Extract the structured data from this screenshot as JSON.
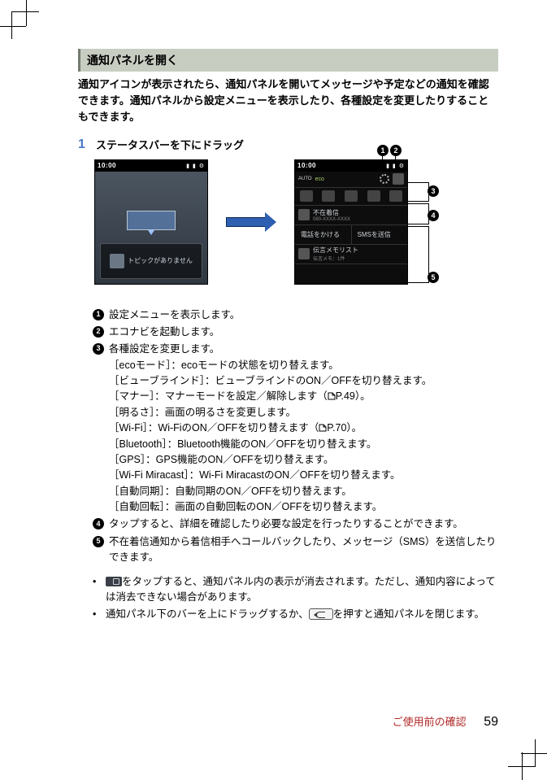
{
  "section_title": "通知パネルを開く",
  "intro": "通知アイコンが表示されたら、通知パネルを開いてメッセージや予定などの通知を確認できます。通知パネルから設定メニューを表示したり、各種設定を変更したりすることもできます。",
  "step": {
    "num": "1",
    "text": "ステータスバーを下にドラッグ"
  },
  "phone": {
    "time": "10:00",
    "dock_text": "トピックがありません",
    "panel": {
      "auto_label": "AUTO",
      "eco_label": "eco",
      "missed_call": "不在着信",
      "missed_number": "080-XXXX-XXXX",
      "call_back": "電話をかける",
      "send_sms": "SMSを送信",
      "memo": "伝言メモリスト",
      "memo_sub": "伝言メモ：1件"
    }
  },
  "callouts": {
    "c1": "1",
    "c2": "2",
    "c3": "3",
    "c4": "4",
    "c5": "5"
  },
  "legend": {
    "l1": "設定メニューを表示します。",
    "l2": "エコナビを起動します。",
    "l3_head": "各種設定を変更します。",
    "l3_items": [
      "［ecoモード］：ecoモードの状態を切り替えます。",
      "［ビューブラインド］：ビューブラインドのON／OFFを切り替えます。",
      {
        "pre": "［マナー］：マナーモードを設定／解除します（",
        "ref": "P.49",
        "post": "）。"
      },
      "［明るさ］：画面の明るさを変更します。",
      {
        "pre": "［Wi-Fi］：Wi-FiのON／OFFを切り替えます（",
        "ref": "P.70",
        "post": "）。"
      },
      "［Bluetooth］：Bluetooth機能のON／OFFを切り替えます。",
      "［GPS］：GPS機能のON／OFFを切り替えます。",
      "［Wi-Fi Miracast］：Wi-Fi MiracastのON／OFFを切り替えます。",
      "［自動同期］：自動同期のON／OFFを切り替えます。",
      "［自動回転］：画面の自動回転のON／OFFを切り替えます。"
    ],
    "l4": "タップすると、詳細を確認したり必要な設定を行ったりすることができます。",
    "l5": "不在着信通知から着信相手へコールバックしたり、メッセージ（SMS）を送信したりできます。"
  },
  "bullets": {
    "b1_pre": "",
    "b1_post": "をタップすると、通知パネル内の表示が消去されます。ただし、通知内容によっては消去できない場合があります。",
    "b2_pre": "通知パネル下のバーを上にドラッグするか、",
    "b2_post": "を押すと通知パネルを閉じます。"
  },
  "footer": {
    "section": "ご使用前の確認",
    "page": "59"
  }
}
